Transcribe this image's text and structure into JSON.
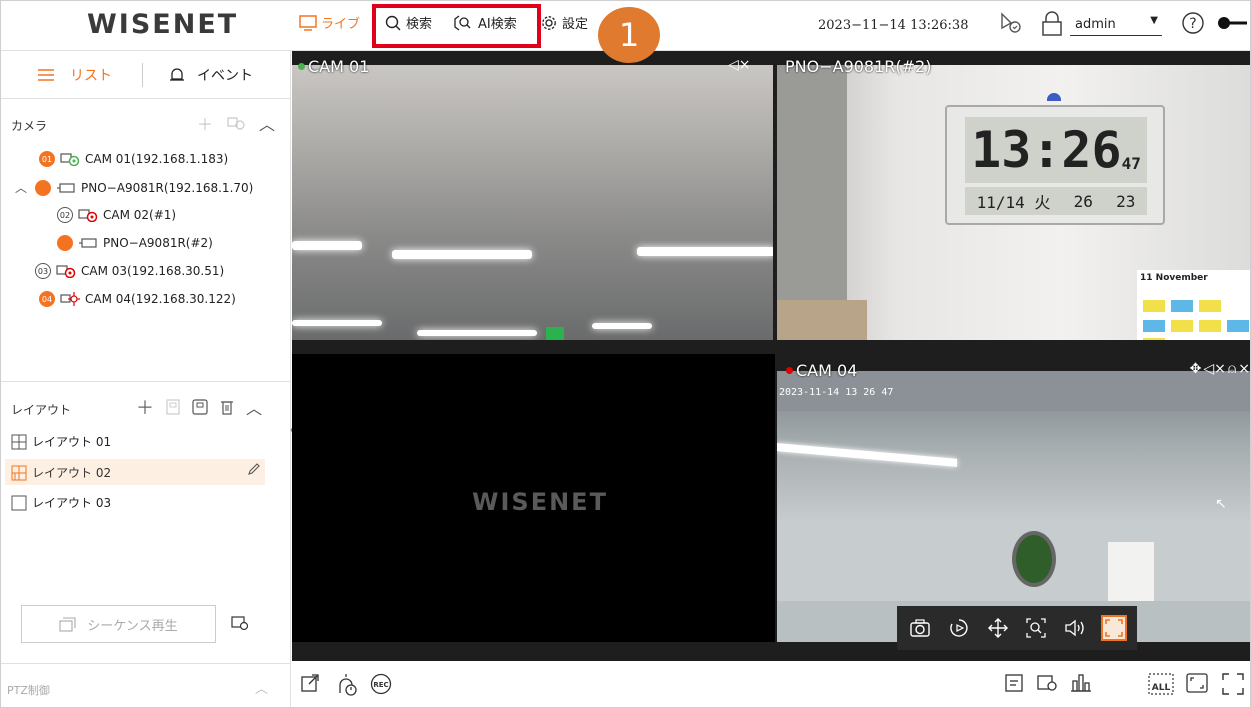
{
  "app": {
    "brand": "WISENET",
    "accent": "#f37321"
  },
  "topnav": {
    "live": "ライブ",
    "search": "検索",
    "ai_search": "AI検索",
    "setup": "設定",
    "datetime": "2023−11−14 13:26:38",
    "user": "admin"
  },
  "annotation": {
    "step": "1",
    "highlight_color": "#e0001b"
  },
  "sidebar": {
    "tab_list": "リスト",
    "tab_event": "イベント",
    "camera_section": "カメラ",
    "cameras": [
      {
        "badge": "01",
        "label": "CAM 01(192.168.1.183)"
      },
      {
        "label": "PNO−A9081R(192.168.1.70)"
      },
      {
        "badge": "02",
        "label": "CAM 02(#1)"
      },
      {
        "label": "PNO−A9081R(#2)"
      },
      {
        "badge": "03",
        "label": "CAM 03(192.168.30.51)"
      },
      {
        "badge": "04",
        "label": "CAM 04(192.168.30.122)"
      }
    ],
    "layout_section": "レイアウト",
    "layouts": [
      {
        "label": "レイアウト 01"
      },
      {
        "label": "レイアウト 02",
        "selected": true
      },
      {
        "label": "レイアウト 03"
      }
    ],
    "sequence_button": "シーケンス再生",
    "ptz_label": "PTZ制御"
  },
  "tiles": [
    {
      "name": "CAM 01",
      "status_color": "#4caf50"
    },
    {
      "name": "PNO−A9081R(#2)"
    },
    {
      "name": "",
      "watermark": "WISENET"
    },
    {
      "name": "CAM 04",
      "status_color": "#e00000",
      "timestamp": "2023-11-14 13 26 47"
    }
  ],
  "clock": {
    "time": "13:26",
    "seconds": "47",
    "date": "11/14 火",
    "temp": "26",
    "humidity": "23"
  },
  "calendar": {
    "title": "11 November"
  }
}
